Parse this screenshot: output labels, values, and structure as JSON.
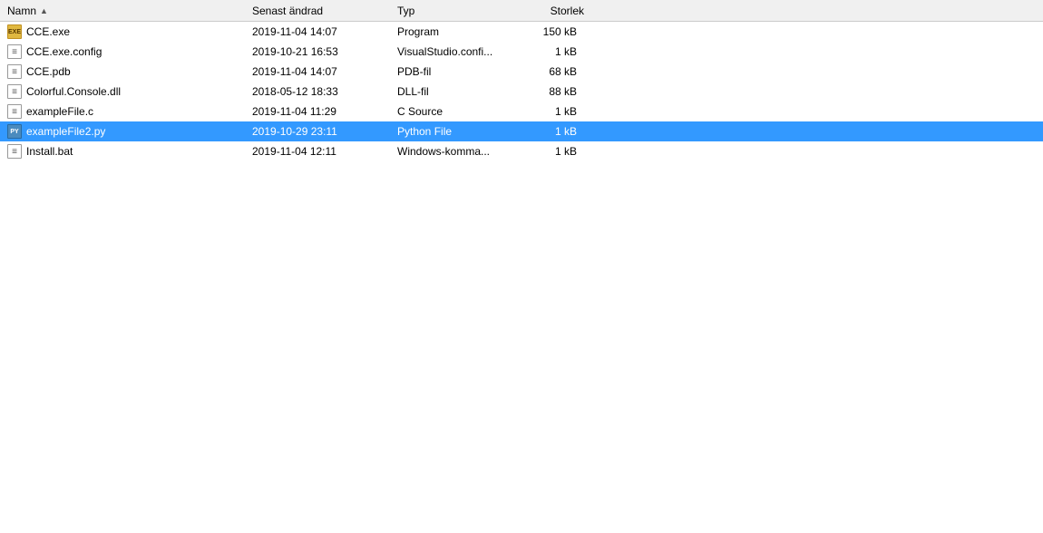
{
  "columns": {
    "name": "Namn",
    "date": "Senast ändrad",
    "type": "Typ",
    "size": "Storlek"
  },
  "files": [
    {
      "name": "CCE.exe",
      "date": "2019-11-04 14:07",
      "type": "Program",
      "size": "150 kB",
      "icon_type": "exe",
      "icon_label": "EXE",
      "selected": false
    },
    {
      "name": "CCE.exe.config",
      "date": "2019-10-21 16:53",
      "type": "VisualStudio.confi...",
      "size": "1 kB",
      "icon_type": "config",
      "icon_label": "📄",
      "selected": false
    },
    {
      "name": "CCE.pdb",
      "date": "2019-11-04 14:07",
      "type": "PDB-fil",
      "size": "68 kB",
      "icon_type": "pdb",
      "icon_label": "📄",
      "selected": false
    },
    {
      "name": "Colorful.Console.dll",
      "date": "2018-05-12 18:33",
      "type": "DLL-fil",
      "size": "88 kB",
      "icon_type": "dll",
      "icon_label": "📄",
      "selected": false
    },
    {
      "name": "exampleFile.c",
      "date": "2019-11-04 11:29",
      "type": "C Source",
      "size": "1 kB",
      "icon_type": "c",
      "icon_label": "📄",
      "selected": false
    },
    {
      "name": "exampleFile2.py",
      "date": "2019-10-29 23:11",
      "type": "Python File",
      "size": "1 kB",
      "icon_type": "py",
      "icon_label": "PY",
      "selected": true
    },
    {
      "name": "Install.bat",
      "date": "2019-11-04 12:11",
      "type": "Windows-komma...",
      "size": "1 kB",
      "icon_type": "bat",
      "icon_label": "📄",
      "selected": false
    }
  ]
}
